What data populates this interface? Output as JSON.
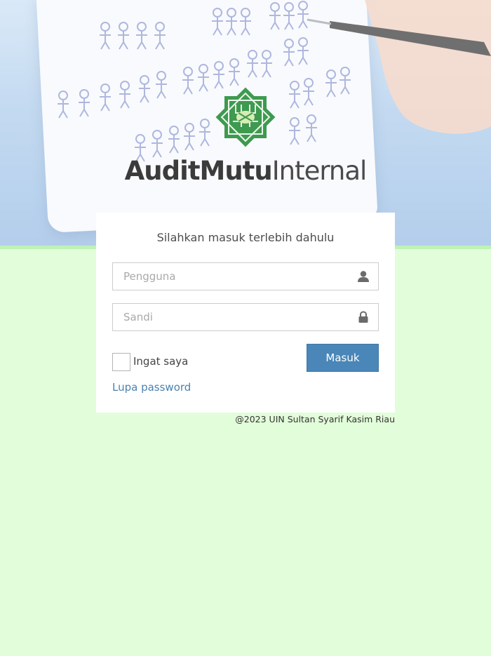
{
  "brand": {
    "title_bold": "AuditMutu",
    "title_light": "Internal",
    "logo_icon": "uin-emblem-icon",
    "logo_color": "#3e9a4f"
  },
  "login": {
    "heading": "Silahkan masuk terlebih dahulu",
    "username": {
      "placeholder": "Pengguna",
      "value": "",
      "icon": "user-icon"
    },
    "password": {
      "placeholder": "Sandi",
      "value": "",
      "icon": "lock-icon"
    },
    "remember_label": "Ingat saya",
    "remember_checked": false,
    "submit_label": "Masuk",
    "forgot_label": "Lupa password"
  },
  "footer": {
    "copyright": "@2023 UIN Sultan Syarif Kasim Riau"
  },
  "colors": {
    "page_background": "#e2fdd9",
    "primary_button": "#4a86b8",
    "link": "#4a82b0"
  }
}
